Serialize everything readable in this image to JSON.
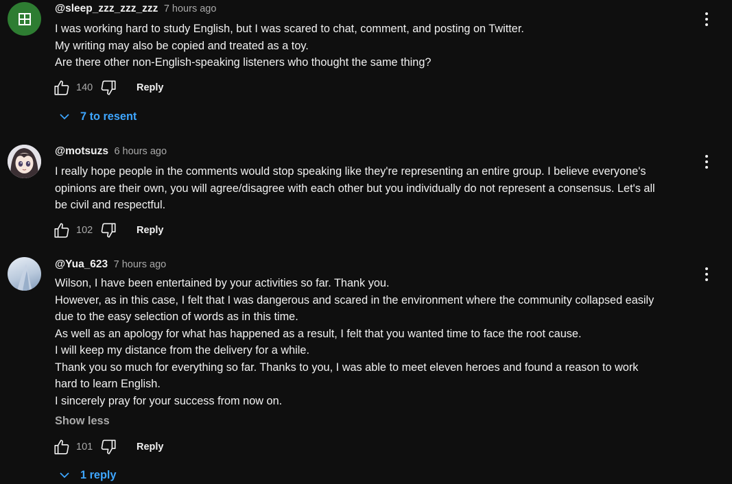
{
  "comments": [
    {
      "author": "@sleep_zzz_zzz_zzz",
      "time": "7 hours ago",
      "avatar_icon": "grid-square-icon",
      "avatar_color": "#2e7d32",
      "lines": [
        "I was working hard to study English, but I was scared to chat, comment, and posting on Twitter.",
        "My writing may also be copied and treated as a toy.",
        "Are there other non-English-speaking listeners who thought the same thing?"
      ],
      "likes": "140",
      "reply_label": "Reply",
      "replies_toggle": "7 to resent"
    },
    {
      "author": "@motsuzs",
      "time": "6 hours ago",
      "lines": [
        "I really hope people in the comments would stop speaking like they're representing an entire group. I believe everyone's",
        "opinions are their own, you will agree/disagree with each other but you individually do not represent a consensus. Let's all",
        "be civil and respectful."
      ],
      "likes": "102",
      "reply_label": "Reply"
    },
    {
      "author": "@Yua_623",
      "time": "7 hours ago",
      "lines": [
        "Wilson, I have been entertained by your activities so far. Thank you.",
        "However, as in this case, I felt that I was dangerous and scared in the environment where the community collapsed easily",
        "due to the easy selection of words as in this time.",
        "As well as an apology for what has happened as a result, I felt that you wanted time to face the root cause.",
        "I will keep my distance from the delivery for a while.",
        "Thank you so much for everything so far. Thanks to you, I was able to meet eleven heroes and found a reason to work",
        "hard to learn English.",
        "I sincerely pray for your success from now on."
      ],
      "show_less": "Show less",
      "likes": "101",
      "reply_label": "Reply",
      "replies_toggle": "1 reply"
    }
  ],
  "accent_color": "#3ea6ff"
}
